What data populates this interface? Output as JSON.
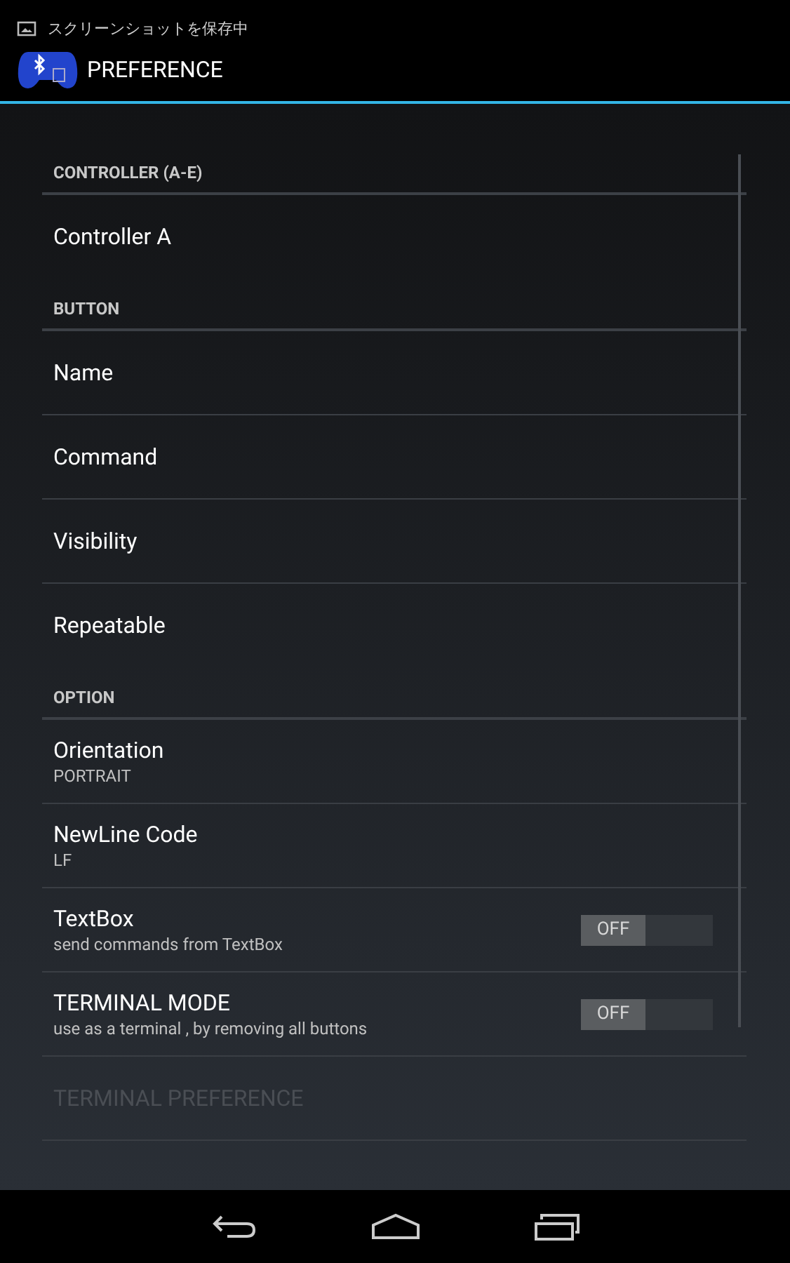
{
  "notification": {
    "text": "スクリーンショットを保存中"
  },
  "action_bar": {
    "title": "PREFERENCE"
  },
  "preferences": [
    {
      "kind": "header",
      "title": "CONTROLLER (A-E)"
    },
    {
      "kind": "item",
      "title": "Controller A"
    },
    {
      "kind": "header",
      "title": "BUTTON"
    },
    {
      "kind": "item",
      "title": "Name"
    },
    {
      "kind": "item",
      "title": "Command"
    },
    {
      "kind": "item",
      "title": "Visibility"
    },
    {
      "kind": "item",
      "title": "Repeatable"
    },
    {
      "kind": "header",
      "title": "OPTION"
    },
    {
      "kind": "item",
      "title": "Orientation",
      "summary": "PORTRAIT"
    },
    {
      "kind": "item",
      "title": "NewLine Code",
      "summary": "LF"
    },
    {
      "kind": "switch",
      "title": "TextBox",
      "summary": "send commands from TextBox",
      "switch_label": "OFF",
      "on": false
    },
    {
      "kind": "switch",
      "title": "TERMINAL MODE",
      "summary": "use as a terminal , by removing all buttons",
      "switch_label": "OFF",
      "on": false
    },
    {
      "kind": "item",
      "title": "TERMINAL PREFERENCE",
      "disabled": true
    }
  ]
}
